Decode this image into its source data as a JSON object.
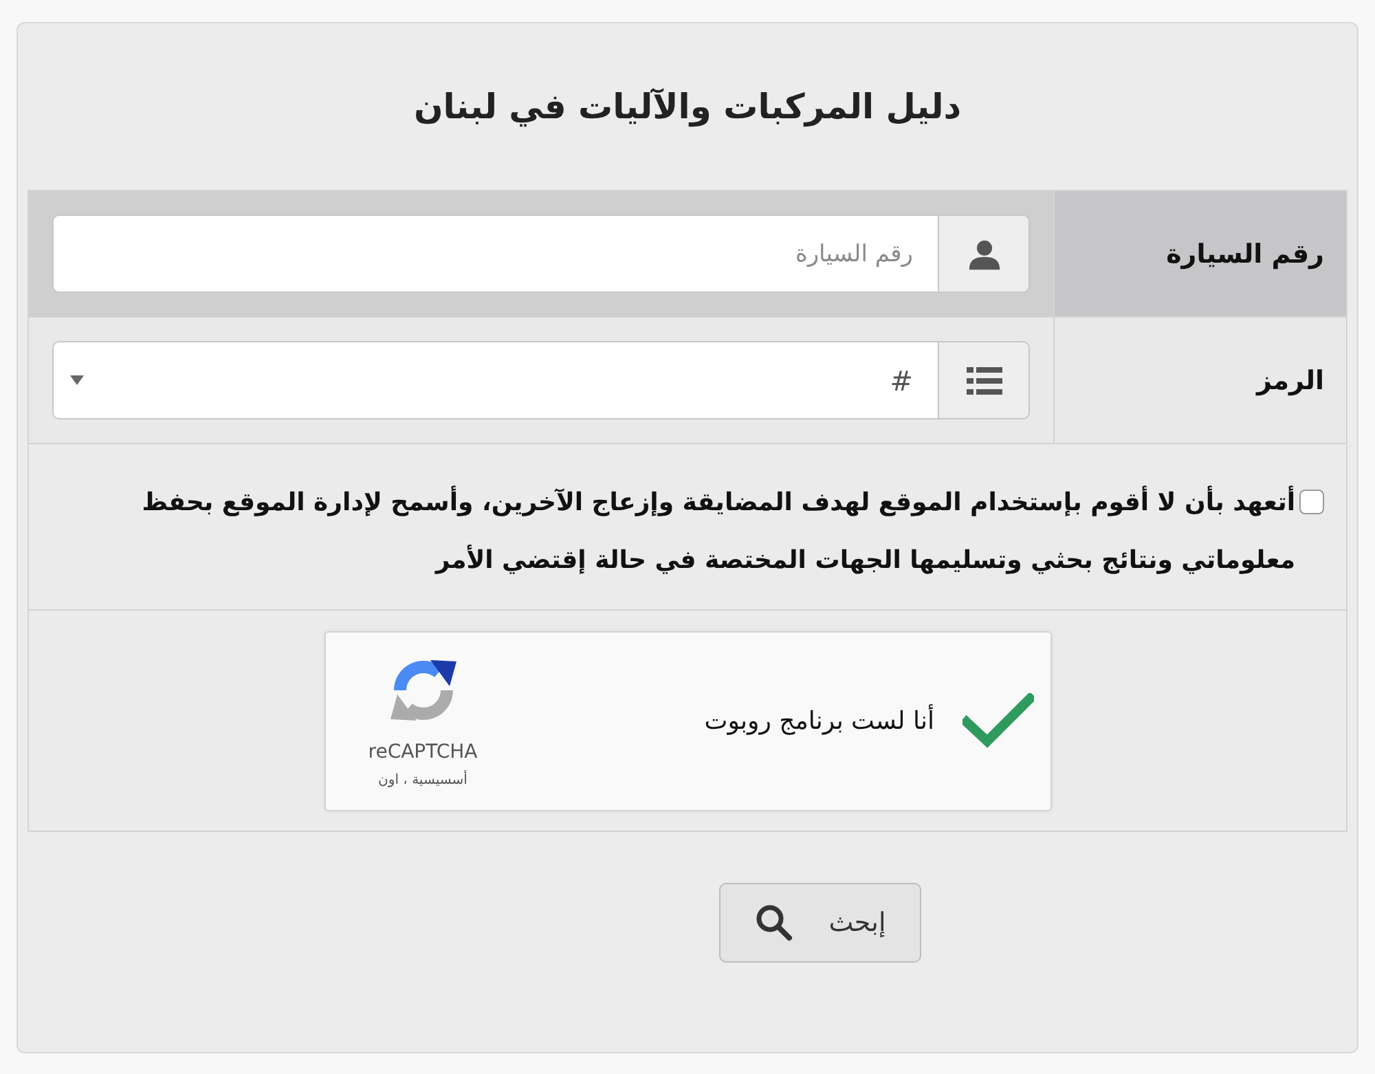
{
  "title": "دليل المركبات والآليات في لبنان",
  "fields": [
    {
      "kind": "text",
      "label": "رقم السيارة",
      "placeholder": "رقم السيارة",
      "highlighted": true
    },
    {
      "kind": "select",
      "label": "الرمز",
      "value": "#",
      "highlighted": false
    }
  ],
  "agreement": {
    "checked": false,
    "text": "أتعهد بأن لا أقوم بإستخدام الموقع لهدف المضايقة وإزعاج الآخرين، وأسمح لإدارة الموقع بحفظ معلوماتي ونتائج بحثي وتسليمها الجهات المختصة في حالة إقتضي الأمر"
  },
  "captcha": {
    "checked": true,
    "label": "أنا لست برنامج روبوت",
    "brand": "reCAPTCHA",
    "links": "أسسيسية ، اون"
  },
  "search_button": {
    "label": "إبحث"
  }
}
